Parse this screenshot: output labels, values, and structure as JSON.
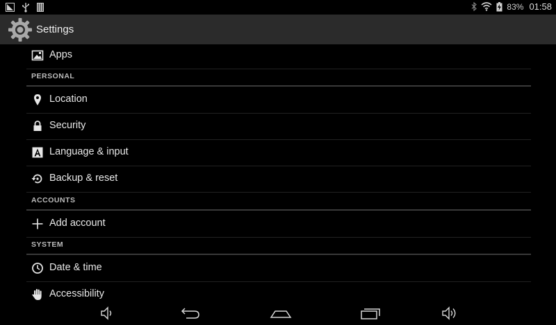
{
  "status_bar": {
    "battery_text": "83%",
    "time": "01:58",
    "left_icons": [
      "screenshot-icon",
      "usb-icon",
      "storage-icon"
    ],
    "right_icons": [
      "bluetooth-icon",
      "wifi-icon",
      "battery-icon"
    ]
  },
  "action_bar": {
    "title": "Settings",
    "icon": "settings-gear-icon"
  },
  "settings": {
    "apps": {
      "label": "Apps",
      "icon": "apps-icon"
    },
    "personal_header": "PERSONAL",
    "location": {
      "label": "Location",
      "icon": "location-pin-icon"
    },
    "security": {
      "label": "Security",
      "icon": "lock-icon"
    },
    "language": {
      "label": "Language & input",
      "icon": "language-icon"
    },
    "backup": {
      "label": "Backup & reset",
      "icon": "backup-icon"
    },
    "accounts_header": "ACCOUNTS",
    "add_account": {
      "label": "Add account",
      "icon": "plus-icon"
    },
    "system_header": "SYSTEM",
    "date_time": {
      "label": "Date & time",
      "icon": "clock-icon"
    },
    "accessibility": {
      "label": "Accessibility",
      "icon": "hand-icon"
    }
  },
  "nav_bar": [
    "volume-down-icon",
    "back-icon",
    "home-icon",
    "recents-icon",
    "volume-up-icon"
  ],
  "colors": {
    "background": "#000000",
    "action_bar": "#2b2b2b",
    "divider": "#3a3a3a",
    "text": "#e8e8e8"
  }
}
